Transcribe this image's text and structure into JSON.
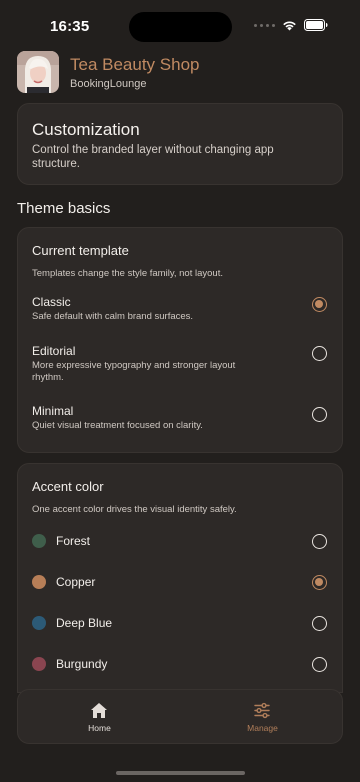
{
  "status_bar": {
    "time": "16:35"
  },
  "header": {
    "shop_name": "Tea Beauty Shop",
    "subtitle": "BookingLounge"
  },
  "hero": {
    "title": "Customization",
    "description": "Control the branded layer without changing app structure."
  },
  "theme_basics": {
    "heading": "Theme basics"
  },
  "template_section": {
    "title": "Current template",
    "subtitle": "Templates change the style family, not layout.",
    "options": [
      {
        "label": "Classic",
        "description": "Safe default with calm brand surfaces.",
        "selected": true
      },
      {
        "label": "Editorial",
        "description": "More expressive typography and stronger layout rhythm.",
        "selected": false
      },
      {
        "label": "Minimal",
        "description": "Quiet visual treatment focused on clarity.",
        "selected": false
      }
    ]
  },
  "accent_section": {
    "title": "Accent color",
    "subtitle": "One accent color drives the visual identity safely.",
    "colors": [
      {
        "label": "Forest",
        "swatch": "#3f5e4b",
        "selected": false
      },
      {
        "label": "Copper",
        "swatch": "#b77e57",
        "selected": true
      },
      {
        "label": "Deep Blue",
        "swatch": "#2c5a77",
        "selected": false
      },
      {
        "label": "Burgundy",
        "swatch": "#8a4550",
        "selected": false
      }
    ]
  },
  "tab_bar": {
    "home_label": "Home",
    "manage_label": "Manage",
    "active_tab": "Manage",
    "accent": "#c08a62"
  }
}
